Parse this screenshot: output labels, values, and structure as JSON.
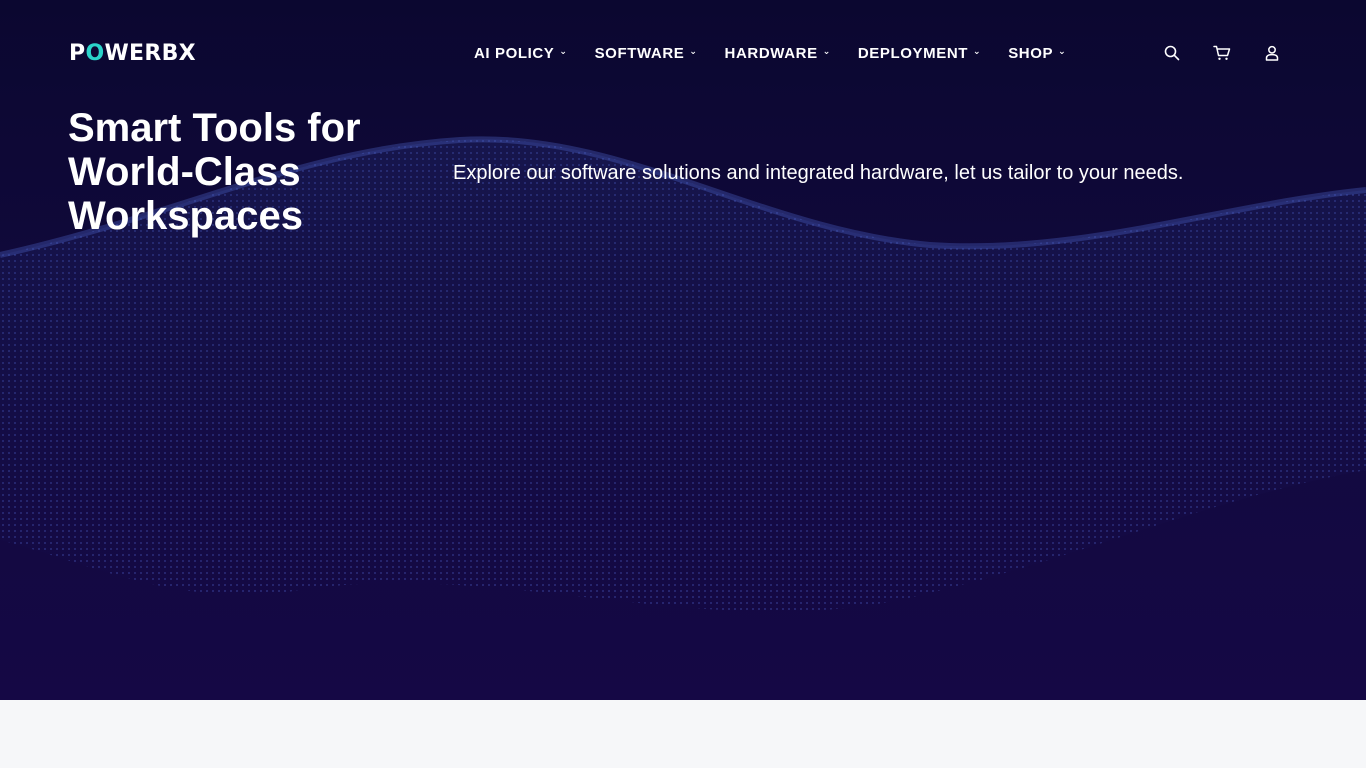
{
  "brand": {
    "logo_pre": "P",
    "logo_o": "O",
    "logo_post": "WERBX"
  },
  "nav": {
    "items": [
      {
        "label": "AI POLICY"
      },
      {
        "label": "SOFTWARE"
      },
      {
        "label": "HARDWARE"
      },
      {
        "label": "DEPLOYMENT"
      },
      {
        "label": "SHOP"
      }
    ]
  },
  "header_icons": [
    "search-icon",
    "cart-icon",
    "user-icon"
  ],
  "hero": {
    "title_lines": [
      "Smart Tools for",
      "World-Class",
      "Workspaces"
    ],
    "subtitle": "Explore our software solutions and integrated hardware, let us tailor to your needs."
  },
  "colors": {
    "hero_bg_top": "#0b0730",
    "hero_bg_bottom": "#150845",
    "logo_accent": "#2bd3c9",
    "text": "#ffffff",
    "page_bg": "#f6f7f9"
  }
}
